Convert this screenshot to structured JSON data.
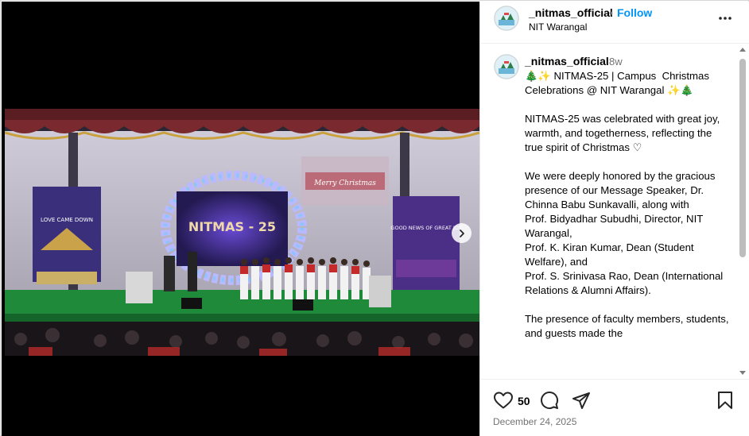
{
  "post": {
    "username": "_nitmas_official",
    "separator": "•",
    "follow_label": "Follow",
    "location": "NIT Warangal",
    "time_ago": "8w",
    "caption": "🎄✨ NITMAS-25 | Campus  Christmas Celebrations @ NIT Warangal ✨🎄\n\nNITMAS-25 was celebrated with great joy, warmth, and togetherness, reflecting the true spirit of Christmas ♡\n\nWe were deeply honored by the gracious presence of our Message Speaker, Dr. Chinna Babu Sunkavalli, along with\nProf. Bidyadhar Subudhi, Director, NIT Warangal,\nProf. K. Kiran Kumar, Dean (Student Welfare), and\nProf. S. Srinivasa Rao, Dean (International Relations & Alumni Affairs).\n\nThe presence of faculty members, students, and guests made the",
    "like_count": "50",
    "date": "December 24, 2025"
  },
  "photo": {
    "banner_title": "NITMAS - 25",
    "left_banner": "LOVE CAME DOWN",
    "right_banner": "GOOD NEWS OF GREAT JOY",
    "screen_text": "Merry Christmas"
  },
  "icons": {
    "more": "more-options-icon",
    "like": "heart-icon",
    "comment": "comment-icon",
    "share": "share-icon",
    "save": "bookmark-icon",
    "next": "chevron-right-icon"
  },
  "colors": {
    "follow": "#0095f6",
    "muted": "#737373",
    "stage_green": "#1f8a3a"
  }
}
